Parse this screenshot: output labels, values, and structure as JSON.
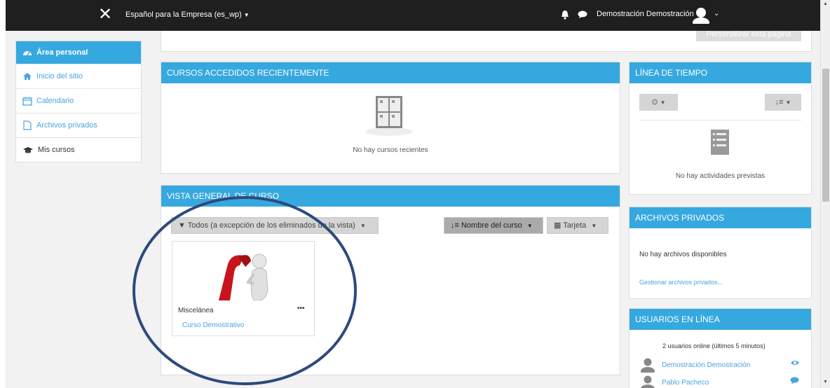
{
  "topbar": {
    "course_selector": "Español para la Empresa (es_wp)",
    "user_name": "Demostración Demostración",
    "icons": [
      "close-icon",
      "bell-icon",
      "chat-icon",
      "avatar-icon",
      "chevron-down-icon"
    ]
  },
  "sidebar": {
    "items": [
      {
        "label": "Área personal",
        "icon": "dashboard-icon",
        "active": true
      },
      {
        "label": "Inicio del sitio",
        "icon": "home-icon"
      },
      {
        "label": "Calendario",
        "icon": "calendar-icon"
      },
      {
        "label": "Archivos privados",
        "icon": "file-icon"
      },
      {
        "label": "Mis cursos",
        "icon": "graduation-cap-icon"
      }
    ]
  },
  "page": {
    "customize_button": "Personalizar esta página"
  },
  "recent_courses": {
    "title": "CURSOS ACCEDIDOS RECIENTEMENTE",
    "empty_text": "No hay cursos recientes"
  },
  "course_overview": {
    "title": "VISTA GENERAL DE CURSO",
    "filter_label": "Todos (a excepción de los eliminados de la vista)",
    "sort_label": "Nombre del curso",
    "view_label": "Tarjeta",
    "courses": [
      {
        "category": "Miscelánea",
        "name": "Curso Demostrativo"
      }
    ]
  },
  "timeline": {
    "title": "LÍNEA DE TIEMPO",
    "empty_text": "No hay actividades previstas"
  },
  "private_files": {
    "title": "ARCHIVOS PRIVADOS",
    "empty_text": "No hay archivos disponibles",
    "manage_link": "Gestionar archivos privados..."
  },
  "online_users": {
    "title": "USUARIOS EN LÍNEA",
    "summary": "2 usuarios online (últimos 5 minutos)",
    "users": [
      {
        "name": "Demostración Demostración",
        "action_icon": "eye-icon"
      },
      {
        "name": "Pablo Pacheco",
        "action_icon": "message-icon"
      }
    ]
  },
  "colors": {
    "accent": "#36a8e0",
    "topbar": "#1f1f1f",
    "link": "#4aa3df",
    "annotation": "#2c4a7c"
  }
}
